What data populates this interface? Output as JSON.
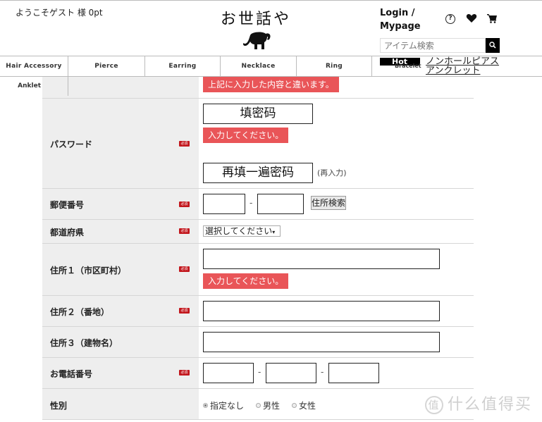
{
  "header": {
    "welcome": "ようこそゲスト 様 0pt",
    "logo_text": "お世話や",
    "login_link": "Login / Mypage",
    "help_icon_glyph": "?",
    "search": {
      "placeholder": "アイテム検索"
    }
  },
  "nav": {
    "items": [
      {
        "label": "Hair Accessory"
      },
      {
        "label": "Pierce"
      },
      {
        "label": "Earring"
      },
      {
        "label": "Necklace"
      },
      {
        "label": "Ring"
      }
    ],
    "hot_badge": "Hot",
    "bracelet": "Bracelet",
    "nonhole_pierce": "ノンホールピアス",
    "anklet_link": "アンクレット",
    "anklet": "Anklet"
  },
  "colors": {
    "error_bg": "#e95558",
    "required_badge": "#c2161c",
    "label_bg": "#eeeeee"
  },
  "form": {
    "required_badge": "必須",
    "confirm_error": "上記に入力した内容と違います。",
    "password": {
      "label": "パスワード",
      "value": "填密码",
      "error": "入力してください。",
      "confirm_value": "再填一遍密码",
      "confirm_note": "(再入力)"
    },
    "zip": {
      "label": "郵便番号",
      "part1": "",
      "part2": "",
      "separator": "-",
      "search_button": "住所検索"
    },
    "prefecture": {
      "label": "都道府県",
      "selected": "選択してください"
    },
    "address1": {
      "label": "住所１（市区町村）",
      "value": "",
      "error": "入力してください。"
    },
    "address2": {
      "label": "住所２（番地）",
      "value": ""
    },
    "address3": {
      "label": "住所３（建物名）",
      "value": ""
    },
    "phone": {
      "label": "お電話番号",
      "part1": "",
      "part2": "",
      "part3": "",
      "separator": "-"
    },
    "gender": {
      "label": "性別",
      "options": [
        {
          "label": "指定なし",
          "selected": true
        },
        {
          "label": "男性",
          "selected": false
        },
        {
          "label": "女性",
          "selected": false
        }
      ]
    }
  },
  "watermark": {
    "circle_glyph": "值",
    "text": "什么值得买"
  }
}
